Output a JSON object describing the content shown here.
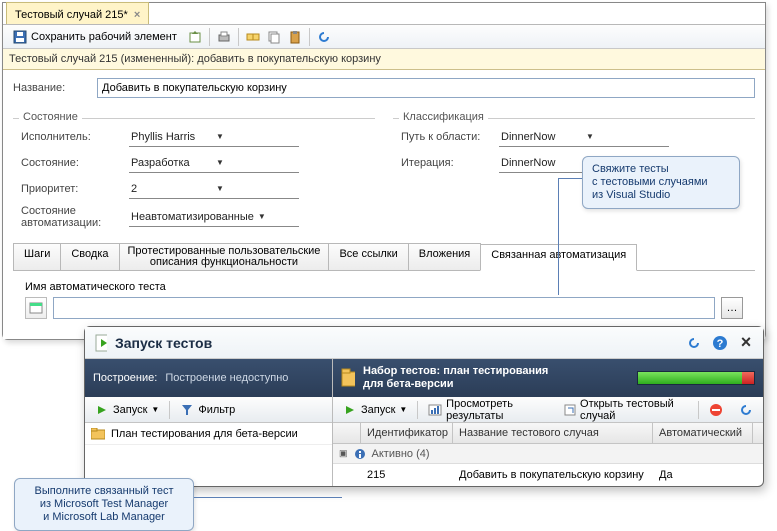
{
  "editor": {
    "tab_title": "Тестовый случай 215*",
    "save_label": "Сохранить рабочий элемент",
    "title_strip": "Тестовый случай 215 (измененный): добавить в покупательскую корзину",
    "name_label": "Название:",
    "name_value": "Добавить в покупательскую корзину",
    "state_group": "Состояние",
    "class_group": "Классификация",
    "fields": {
      "assignee_label": "Исполнитель:",
      "assignee_value": "Phyllis Harris",
      "state_label": "Состояние:",
      "state_value": "Разработка",
      "priority_label": "Приоритет:",
      "priority_value": "2",
      "autostate_label": "Состояние автоматизации:",
      "autostate_value": "Неавтоматизированные",
      "areapath_label": "Путь к области:",
      "areapath_value": "DinnerNow",
      "iteration_label": "Итерация:",
      "iteration_value": "DinnerNow"
    },
    "tabs": [
      "Шаги",
      "Сводка",
      "Протестированные пользовательские\nописания функциональности",
      "Все ссылки",
      "Вложения",
      "Связанная автоматизация"
    ],
    "active_tab": 5,
    "automation": {
      "label": "Имя автоматического теста",
      "value": ""
    }
  },
  "callout1": "Свяжите тесты\nс тестовыми случаями\nиз Visual Studio",
  "callout2": "Выполните связанный тест\nиз Microsoft Test Manager\nи Microsoft Lab Manager",
  "runner": {
    "title": "Запуск тестов",
    "build_label": "Построение:",
    "build_value": "Построение недоступно",
    "run_label": "Запуск",
    "filter_label": "Фильтр",
    "plan_item": "План тестирования для бета-версии",
    "suite_label": "Набор тестов: план тестирования\nдля бета-версии",
    "view_results": "Просмотреть результаты",
    "open_case": "Открыть тестовый случай",
    "columns": {
      "id": "Идентификатор",
      "name": "Название тестового случая",
      "auto": "Автоматический"
    },
    "group_row": "Активно (4)",
    "row": {
      "id": "215",
      "name": "Добавить в покупательскую корзину",
      "auto": "Да"
    }
  },
  "icons": {
    "save": "💾",
    "print": "🖨",
    "refresh": "🔄",
    "close": "×",
    "help": "?",
    "play": "▶"
  }
}
